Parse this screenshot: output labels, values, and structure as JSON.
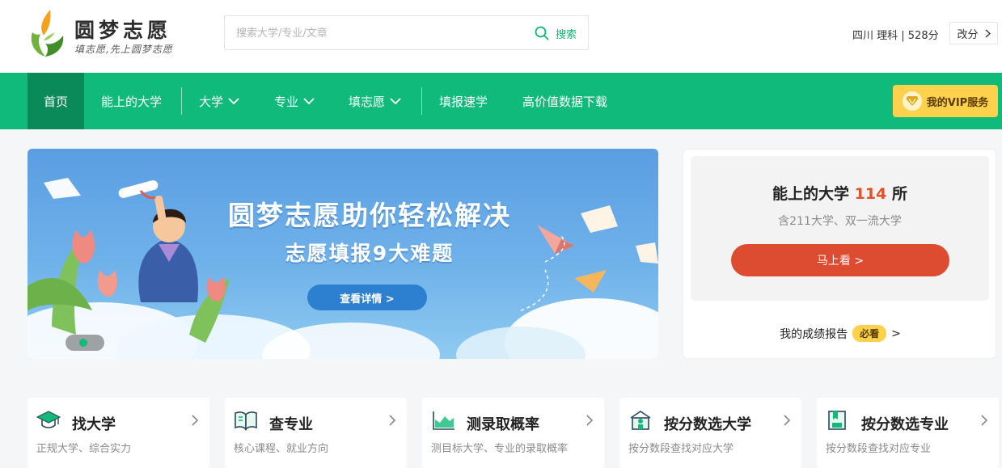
{
  "brand": {
    "name": "圆梦志愿",
    "slogan": "填志愿,先上圆梦志愿",
    "colors": {
      "primary": "#10ba7a",
      "primary_dark": "#0a8a58",
      "accent": "#dd4b30",
      "vip": "#fcd24c"
    }
  },
  "search": {
    "placeholder": "搜索大学/专业/文章",
    "value": "",
    "button_label": "搜索",
    "icon": "search-icon"
  },
  "user": {
    "info": "四川 理科 | 528分",
    "edit_label": "改分"
  },
  "nav": {
    "items": [
      {
        "label": "首页",
        "active": true
      },
      {
        "label": "能上的大学"
      },
      {
        "label": "大学",
        "dropdown": true
      },
      {
        "label": "专业",
        "dropdown": true
      },
      {
        "label": "填志愿",
        "dropdown": true
      },
      {
        "label": "填报速学"
      },
      {
        "label": "高价值数据下载"
      }
    ],
    "vip_label": "我的VIP服务"
  },
  "banner": {
    "title": "圆梦志愿助你轻松解决",
    "subtitle": "志愿填报9大难题",
    "button_label": "查看详情 >"
  },
  "side": {
    "title_prefix": "能上的大学",
    "count": "114",
    "title_suffix": "所",
    "desc": "含211大学、双一流大学",
    "button_label": "马上看 >",
    "report_label": "我的成绩报告",
    "report_badge": "必看",
    "report_arrow": ">"
  },
  "features": [
    {
      "title": "找大学",
      "desc": "正规大学、综合实力",
      "icon": "graduation-cap-icon"
    },
    {
      "title": "查专业",
      "desc": "核心课程、就业方向",
      "icon": "open-book-icon"
    },
    {
      "title": "测录取概率",
      "desc": "测目标大学、专业的录取概率",
      "icon": "area-chart-icon"
    },
    {
      "title": "按分数选大学",
      "desc": "按分数段查找对应大学",
      "icon": "university-building-icon"
    },
    {
      "title": "按分数选专业",
      "desc": "按分数段查找对应专业",
      "icon": "bookmark-book-icon"
    }
  ]
}
